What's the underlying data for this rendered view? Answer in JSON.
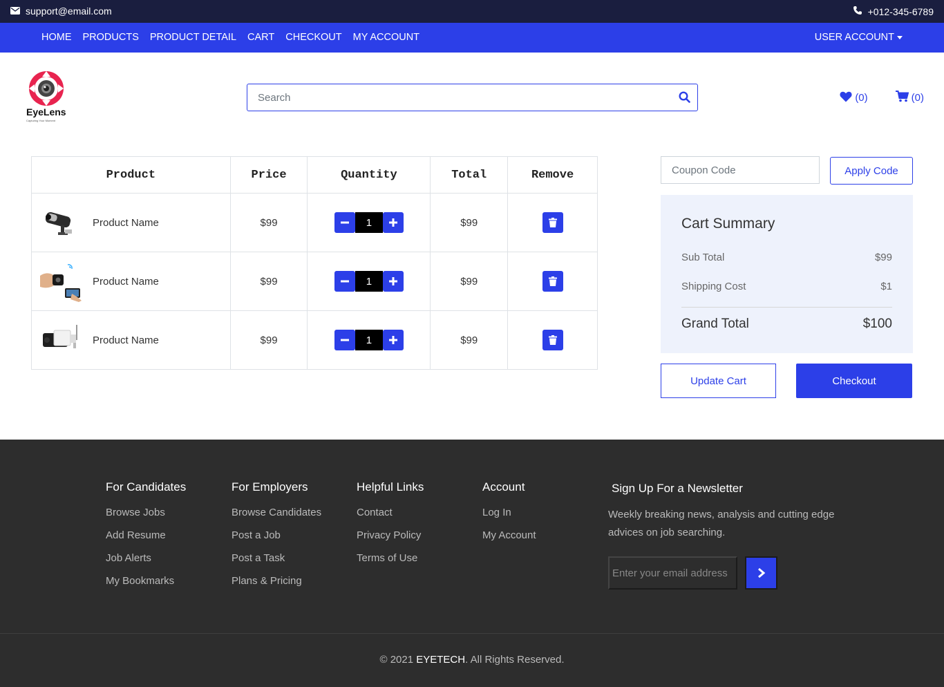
{
  "topbar": {
    "email": "support@email.com",
    "phone": "+012-345-6789"
  },
  "nav": {
    "links": [
      "HOME",
      "PRODUCTS",
      "PRODUCT DETAIL",
      "CART",
      "CHECKOUT",
      "MY ACCOUNT"
    ],
    "user_account": "USER ACCOUNT"
  },
  "logo": {
    "name": "EyeLens",
    "tagline": "Capturing Your Moment"
  },
  "search": {
    "placeholder": "Search"
  },
  "header_icons": {
    "wishlist_count": "(0)",
    "cart_count": "(0)"
  },
  "cart_table": {
    "headers": [
      "Product",
      "Price",
      "Quantity",
      "Total",
      "Remove"
    ],
    "rows": [
      {
        "name": "Product Name",
        "price": "$99",
        "qty": "1",
        "total": "$99",
        "image": "cctv-camera"
      },
      {
        "name": "Product Name",
        "price": "$99",
        "qty": "1",
        "total": "$99",
        "image": "mini-spy-camera"
      },
      {
        "name": "Product Name",
        "price": "$99",
        "qty": "1",
        "total": "$99",
        "image": "bullet-camera"
      }
    ]
  },
  "coupon": {
    "placeholder": "Coupon Code",
    "apply_label": "Apply Code"
  },
  "summary": {
    "title": "Cart Summary",
    "subtotal_label": "Sub Total",
    "subtotal_value": "$99",
    "shipping_label": "Shipping Cost",
    "shipping_value": "$1",
    "grand_label": "Grand Total",
    "grand_value": "$100"
  },
  "actions": {
    "update_label": "Update Cart",
    "checkout_label": "Checkout"
  },
  "footer": {
    "columns": [
      {
        "title": "For Candidates",
        "links": [
          "Browse Jobs",
          "Add Resume",
          "Job Alerts",
          "My Bookmarks"
        ]
      },
      {
        "title": "For Employers",
        "links": [
          "Browse Candidates",
          "Post a Job",
          "Post a Task",
          "Plans & Pricing"
        ]
      },
      {
        "title": "Helpful Links",
        "links": [
          "Contact",
          "Privacy Policy",
          "Terms of Use"
        ]
      },
      {
        "title": "Account",
        "links": [
          "Log In",
          "My Account"
        ]
      }
    ],
    "newsletter": {
      "title": "Sign Up For a Newsletter",
      "text": "Weekly breaking news, analysis and cutting edge advices on job searching.",
      "placeholder": "Enter your email address"
    },
    "copyright_prefix": "© 2021 ",
    "copyright_brand": "EYETECH",
    "copyright_suffix": ". All Rights Reserved."
  },
  "colors": {
    "primary": "#2c3fe8",
    "topbar": "#1a1e3f",
    "footer": "#2d2d2d",
    "summary_bg": "#eef2fc",
    "logo_red": "#e8244f"
  }
}
